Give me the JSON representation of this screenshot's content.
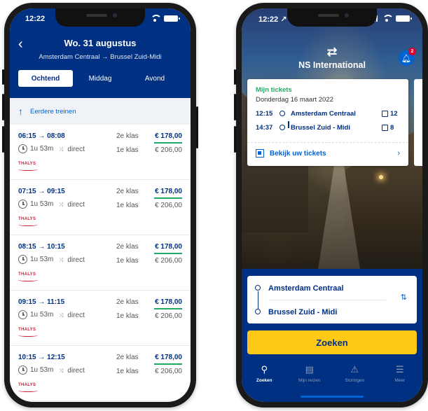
{
  "left": {
    "status_time": "12:22",
    "back_icon": "chevron-left-icon",
    "title": "Wo. 31 augustus",
    "route": "Amsterdam Centraal  →  Brussel Zuid-Midi",
    "segments": [
      "Ochtend",
      "Middag",
      "Avond"
    ],
    "active_segment": "Ochtend",
    "earlier_label": "Eerdere treinen",
    "trips": [
      {
        "times": "06:15 → 08:08",
        "duration": "1u 53m",
        "type": "direct",
        "operator": "THALYS",
        "class2": "2e klas",
        "price2": "€ 178,00",
        "class1": "1e klas",
        "price1": "€ 206,00"
      },
      {
        "times": "07:15 → 09:15",
        "duration": "1u 53m",
        "type": "direct",
        "operator": "THALYS",
        "class2": "2e klas",
        "price2": "€ 178,00",
        "class1": "1e klas",
        "price1": "€ 206,00"
      },
      {
        "times": "08:15 → 10:15",
        "duration": "1u 53m",
        "type": "direct",
        "operator": "THALYS",
        "class2": "2e klas",
        "price2": "€ 178,00",
        "class1": "1e klas",
        "price1": "€ 206,00"
      },
      {
        "times": "09:15 → 11:15",
        "duration": "1u 53m",
        "type": "direct",
        "operator": "THALYS",
        "class2": "2e klas",
        "price2": "€ 178,00",
        "class1": "1e klas",
        "price1": "€ 206,00"
      },
      {
        "times": "10:15 → 12:15",
        "duration": "1u 53m",
        "type": "direct",
        "operator": "THALYS",
        "class2": "2e klas",
        "price2": "€ 178,00",
        "class1": "1e klas",
        "price1": "€ 206,00"
      }
    ]
  },
  "right": {
    "status_time": "12:22 ↗",
    "logo_mark": "⇄",
    "app_title": "NS International",
    "notification_count": "2",
    "ticket": {
      "title": "Mijn tickets",
      "date": "Donderdag 16 maart 2022",
      "dep_time": "12:15",
      "dep_station": "Amsterdam Centraal",
      "dep_platform": "12",
      "arr_time": "14:37",
      "arr_station": "Brussel Zuid - Midi",
      "arr_platform": "8",
      "view_label": "Bekijk uw tickets"
    },
    "planner": {
      "from": "Amsterdam Centraal",
      "to": "Brussel Zuid - Midi"
    },
    "search_label": "Zoeken",
    "tabs": [
      {
        "label": "Zoeken",
        "icon": "search-icon"
      },
      {
        "label": "Mijn reizen",
        "icon": "tickets-icon"
      },
      {
        "label": "Storingen",
        "icon": "warning-icon"
      },
      {
        "label": "Meer",
        "icon": "menu-icon"
      }
    ]
  },
  "colors": {
    "ns_blue": "#003082",
    "link_blue": "#0063d3",
    "ns_yellow": "#ffc917",
    "green": "#1fab62",
    "thalys_red": "#c61f3a"
  }
}
